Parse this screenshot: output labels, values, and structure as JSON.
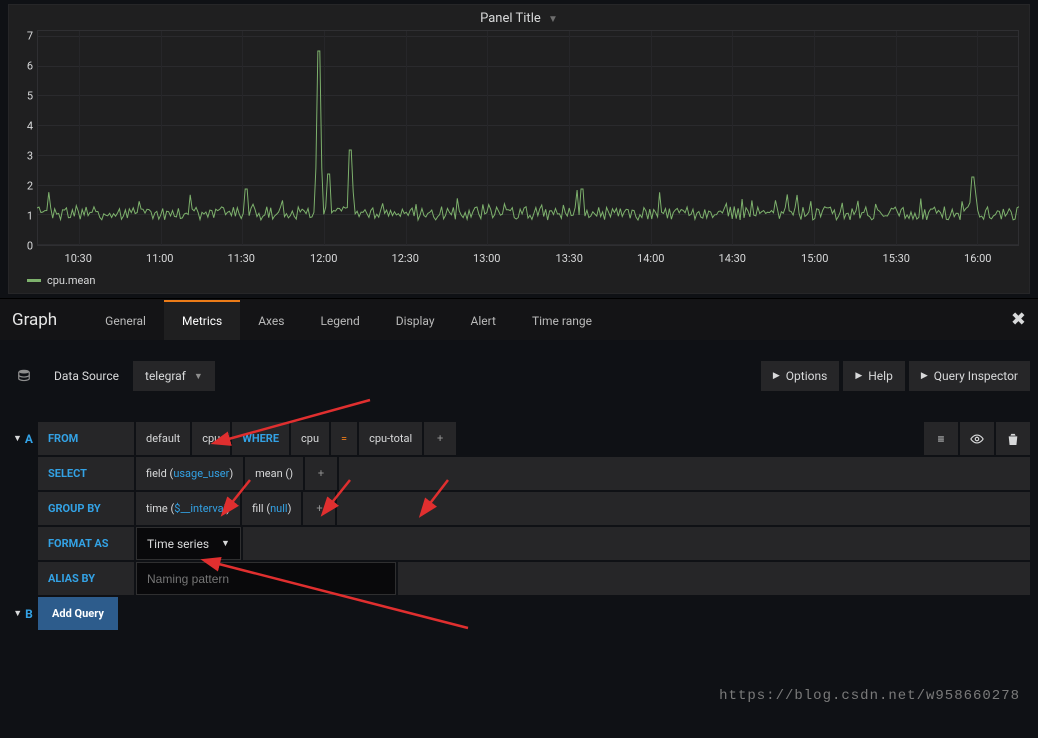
{
  "panel": {
    "title": "Panel Title"
  },
  "chart_data": {
    "type": "line",
    "title": "Panel Title",
    "xlabel": "",
    "ylabel": "",
    "ylim": [
      0,
      7.2
    ],
    "y_ticks": [
      0,
      1,
      2,
      3,
      4,
      5,
      6,
      7
    ],
    "x_ticks": [
      "10:30",
      "11:00",
      "11:30",
      "12:00",
      "12:30",
      "13:00",
      "13:30",
      "14:00",
      "14:30",
      "15:00",
      "15:30",
      "16:00"
    ],
    "series": [
      {
        "name": "cpu.mean",
        "color": "#7eb26d",
        "baseline": 1.0,
        "note": "noisy CPU mean ~1% with spikes; notable spikes values are estimates",
        "spikes": [
          {
            "x": "11:32",
            "y": 1.9
          },
          {
            "x": "11:58",
            "y": 6.5
          },
          {
            "x": "12:02",
            "y": 2.4
          },
          {
            "x": "12:10",
            "y": 3.2
          },
          {
            "x": "13:35",
            "y": 1.9
          },
          {
            "x": "15:58",
            "y": 2.3
          }
        ]
      }
    ],
    "legend": [
      "cpu.mean"
    ]
  },
  "legend": {
    "series0": "cpu.mean"
  },
  "editor": {
    "title": "Graph",
    "tabs": {
      "general": "General",
      "metrics": "Metrics",
      "axes": "Axes",
      "legend": "Legend",
      "display": "Display",
      "alert": "Alert",
      "time_range": "Time range"
    }
  },
  "datasource": {
    "label": "Data Source",
    "selected": "telegraf",
    "options_btn": "Options",
    "help_btn": "Help",
    "inspector_btn": "Query Inspector"
  },
  "queryA": {
    "letter": "A",
    "from_kw": "FROM",
    "policy": "default",
    "measurement": "cpu",
    "where_kw": "WHERE",
    "tag_key": "cpu",
    "op": "=",
    "tag_val": "cpu-total",
    "select_kw": "SELECT",
    "field_fn": "field",
    "field_arg": "usage_user",
    "agg": "mean ()",
    "groupby_kw": "GROUP BY",
    "time_fn": "time",
    "time_arg": "$__interval",
    "fill_fn": "fill",
    "fill_arg": "null",
    "format_kw": "FORMAT AS",
    "format_val": "Time series",
    "alias_kw": "ALIAS BY",
    "alias_placeholder": "Naming pattern"
  },
  "queryB": {
    "letter": "B",
    "add_query": "Add Query"
  },
  "watermark": "https://blog.csdn.net/w958660278"
}
